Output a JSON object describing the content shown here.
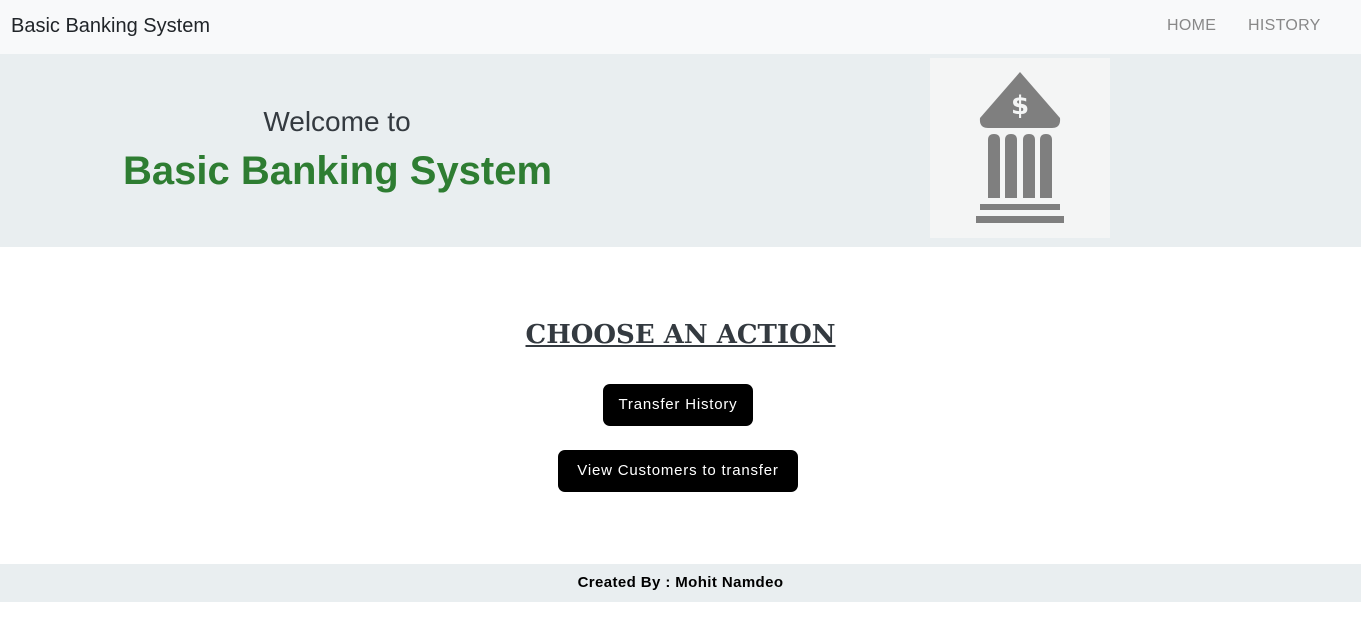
{
  "navbar": {
    "brand": "Basic Banking System",
    "links": [
      {
        "label": "HOME"
      },
      {
        "label": "HISTORY"
      }
    ]
  },
  "hero": {
    "welcome": "Welcome to",
    "title": "Basic Banking System",
    "title_color": "#2e7d32",
    "image_icon": "bank-building-dollar-icon"
  },
  "main": {
    "heading": "CHOOSE AN ACTION",
    "buttons": [
      {
        "label": "Transfer History"
      },
      {
        "label": "View Customers to transfer"
      }
    ]
  },
  "footer": {
    "text": "Created By : Mohit Namdeo"
  }
}
